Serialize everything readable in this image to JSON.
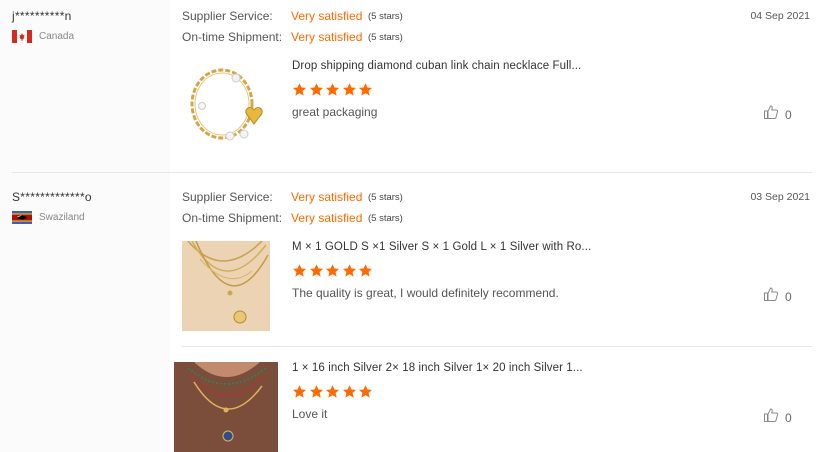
{
  "reviews": [
    {
      "user": "j**********n",
      "country": "Canada",
      "supplier_label": "Supplier Service:",
      "supplier_value": "Very satisfied",
      "supplier_stars": "(5 stars)",
      "shipment_label": "On-time Shipment:",
      "shipment_value": "Very satisfied",
      "shipment_stars": "(5 stars)",
      "date": "04 Sep 2021",
      "items": [
        {
          "product": "Drop shipping diamond cuban link chain necklace Full...",
          "rating": 5,
          "comment": "great packaging",
          "likes": "0"
        }
      ]
    },
    {
      "user": "S*************o",
      "country": "Swaziland",
      "supplier_label": "Supplier Service:",
      "supplier_value": "Very satisfied",
      "supplier_stars": "(5 stars)",
      "shipment_label": "On-time Shipment:",
      "shipment_value": "Very satisfied",
      "shipment_stars": "(5 stars)",
      "date": "03 Sep 2021",
      "items": [
        {
          "product": "M × 1 GOLD S ×1 Silver S × 1 Gold L × 1 Silver with Ro...",
          "rating": 5,
          "comment": "The quality is great,  I would definitely recommend.",
          "likes": "0"
        },
        {
          "product": "1 × 16 inch Silver 2× 18 inch Silver 1× 20 inch Silver 1...",
          "rating": 5,
          "comment": "Love it",
          "likes": "0"
        }
      ]
    }
  ],
  "colors": {
    "accent": "#ff6a00",
    "star": "#ff6a00"
  },
  "icons": {
    "like": "thumbs-up-icon",
    "star": "star-icon"
  }
}
